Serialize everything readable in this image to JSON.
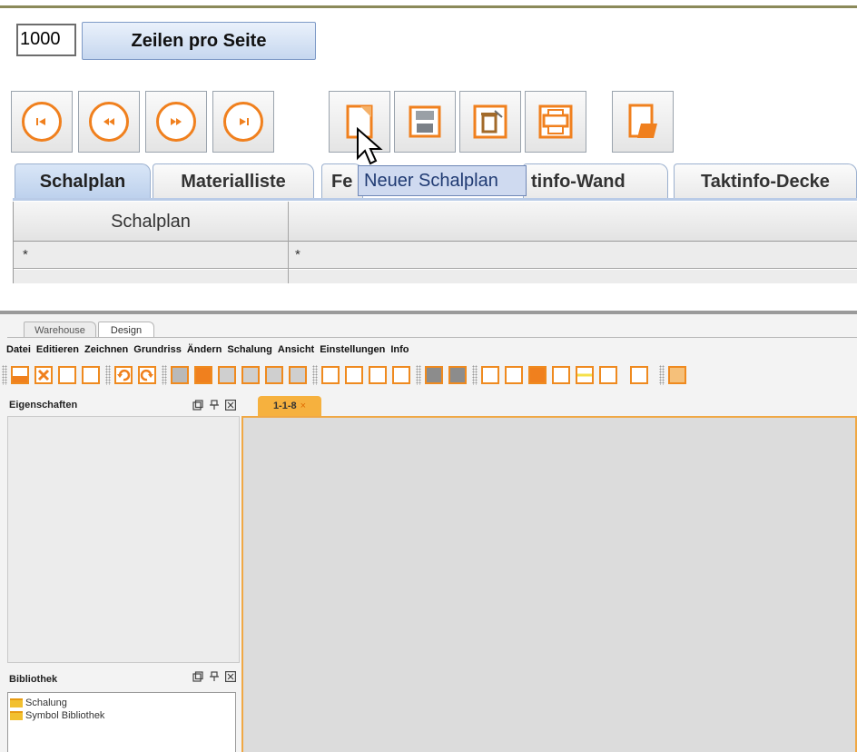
{
  "top": {
    "rows_value": "1000",
    "rows_button_label": "Zeilen pro Seite",
    "nav_buttons": [
      "first-icon",
      "previous-icon",
      "next-icon",
      "last-icon"
    ],
    "tool_buttons": [
      "new-document-icon",
      "save-icon",
      "delete-icon",
      "print-icon",
      "export-icon"
    ],
    "tooltip": "Neuer Schalplan",
    "tabs": [
      "Schalplan",
      "Materialliste",
      "Fe",
      "tinfo-Wand",
      "Taktinfo-Decke"
    ],
    "table": {
      "header": [
        "Schalplan",
        ""
      ],
      "filter_row": [
        "*",
        "*"
      ]
    },
    "colors": {
      "accent": "#f0801e",
      "tab_active": "#c7d8ef",
      "tooltip_bg": "#cfdaf0"
    }
  },
  "app": {
    "tabs": [
      "Warehouse",
      "Design"
    ],
    "menu": [
      "Datei",
      "Editieren",
      "Zeichnen",
      "Grundriss",
      "Ändern",
      "Schalung",
      "Ansicht",
      "Einstellungen",
      "Info"
    ],
    "panels": {
      "properties_title": "Eigenschaften",
      "library_title": "Bibliothek",
      "library_items": [
        "Schalung",
        "Symbol Bibliothek"
      ]
    },
    "document_tab": "1-1-8",
    "document_tab_close": "×",
    "colors": {
      "accent": "#f0a844",
      "canvas": "#dcdcdc"
    }
  }
}
